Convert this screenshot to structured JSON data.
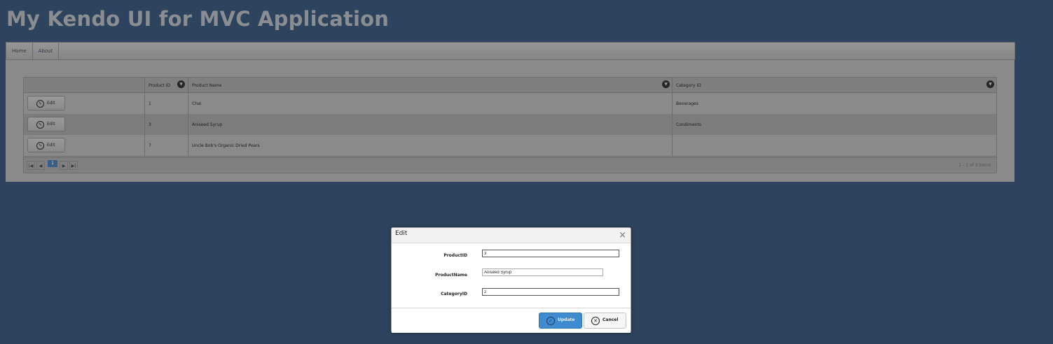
{
  "app": {
    "title": "My Kendo UI for MVC Application"
  },
  "menu": {
    "items": [
      {
        "label": "Home"
      },
      {
        "label": "About"
      }
    ]
  },
  "grid": {
    "columns": [
      {
        "label": ""
      },
      {
        "label": "Product ID"
      },
      {
        "label": "Product Name"
      },
      {
        "label": "Category ID"
      }
    ],
    "edit_label": "Edit",
    "rows": [
      {
        "product_id": "1",
        "product_name": "Chai",
        "category": "Beverages"
      },
      {
        "product_id": "3",
        "product_name": "Aniseed Syrup",
        "category": "Condiments"
      },
      {
        "product_id": "7",
        "product_name": "Uncle Bob's Organic Dried Pears",
        "category": ""
      }
    ],
    "pager": {
      "first_icon": "|◀",
      "prev_icon": "◀",
      "next_icon": "▶",
      "last_icon": "▶|",
      "current_page": "1",
      "info": "1 - 3 of 3 items"
    }
  },
  "modal": {
    "title": "Edit",
    "close_icon": "×",
    "fields": [
      {
        "label": "ProductID",
        "value": "3"
      },
      {
        "label": "ProductName",
        "value": "Aniseed Syrup"
      },
      {
        "label": "CategoryID",
        "value": "2"
      }
    ],
    "update_label": "Update",
    "cancel_label": "Cancel",
    "update_icon": "✓",
    "cancel_icon": "✕"
  },
  "colors": {
    "background": "#2e435e",
    "overlay_panel": "#8a8a8a",
    "primary_button": "#3f8bd0"
  }
}
